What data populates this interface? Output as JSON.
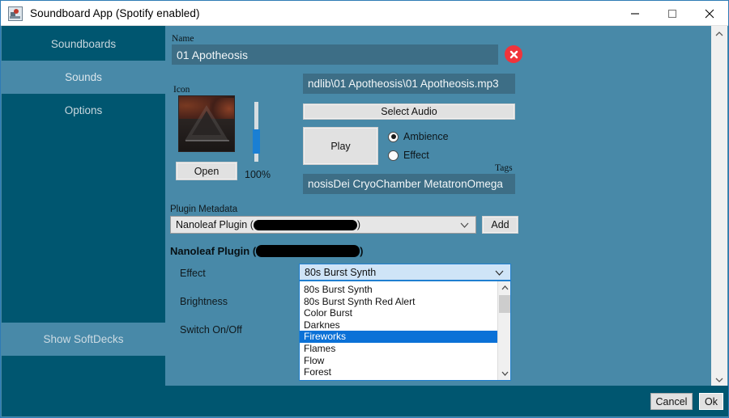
{
  "window": {
    "title": "Soundboard App (Spotify enabled)",
    "app_icon": "speaker-app-icon",
    "minimize": "–",
    "maximize": "▢",
    "close": "✕",
    "border_color": "#2e7bb5",
    "background": "#4889a8",
    "sidebar_color": "#005670"
  },
  "sidebar": {
    "items": [
      {
        "label": "Soundboards",
        "active": false
      },
      {
        "label": "Sounds",
        "active": true
      },
      {
        "label": "Options",
        "active": false
      }
    ],
    "bottom_item": {
      "label": "Show SoftDecks"
    }
  },
  "main": {
    "name_label": "Name",
    "name_value": "01 Apotheosis",
    "delete_button": "delete-sound-button",
    "icon_label": "Icon",
    "open_button": "Open",
    "volume_percent": "100%",
    "audio_path": "ndlib\\01 Apotheosis\\01 Apotheosis.mp3",
    "select_audio_button": "Select Audio",
    "play_button": "Play",
    "radio_options": [
      {
        "label": "Ambience",
        "selected": true
      },
      {
        "label": "Effect",
        "selected": false
      }
    ],
    "tags_label": "Tags",
    "tags_value": "nosisDei CryoChamber MetatronOmega",
    "plugin_metadata_label": "Plugin Metadata",
    "plugin_metadata_prefix": "Nanoleaf Plugin (",
    "plugin_metadata_suffix": ")",
    "add_button": "Add",
    "plugin_section_prefix": "Nanoleaf Plugin (",
    "plugin_section_suffix": ")",
    "fields": [
      {
        "label": "Effect"
      },
      {
        "label": "Brightness"
      },
      {
        "label": "Switch On/Off"
      }
    ],
    "effect_selected": "80s Burst Synth",
    "effect_options": [
      {
        "label": "80s Burst Synth",
        "selected": false
      },
      {
        "label": "80s Burst Synth Red Alert",
        "selected": false
      },
      {
        "label": "Color Burst",
        "selected": false
      },
      {
        "label": "Darknes",
        "selected": false
      },
      {
        "label": "Fireworks",
        "selected": true
      },
      {
        "label": "Flames",
        "selected": false
      },
      {
        "label": "Flow",
        "selected": false
      },
      {
        "label": "Forest",
        "selected": false
      }
    ]
  },
  "footer": {
    "cancel_button": "Cancel",
    "ok_button": "Ok"
  },
  "colors": {
    "accent": "#005670",
    "background": "#4889a8",
    "field": "#3d6e86",
    "selection": "#0b71d7",
    "danger": "#f0343b"
  }
}
